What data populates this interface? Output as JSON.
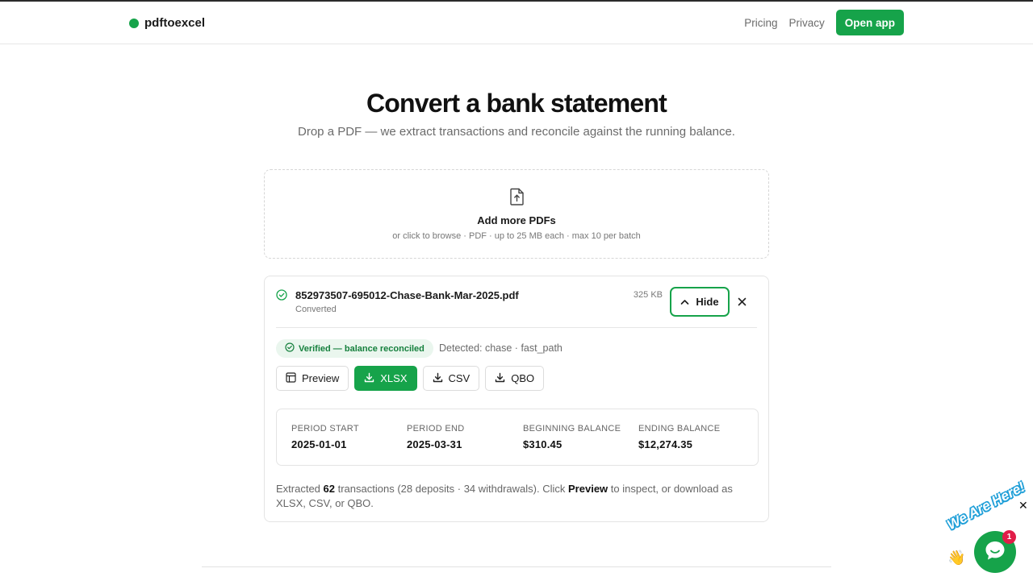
{
  "header": {
    "brand": "pdftoexcel",
    "nav": [
      {
        "label": "Pricing"
      },
      {
        "label": "Privacy"
      }
    ],
    "cta_label": "Open app"
  },
  "hero": {
    "title": "Convert a bank statement",
    "subtitle": "Drop a PDF — we extract transactions and reconcile against the running balance."
  },
  "dropzone": {
    "icon": "file-upload-icon",
    "title": "Add more PDFs",
    "hint": "or click to browse · PDF · up to 25 MB each · max 10 per batch"
  },
  "file": {
    "name": "852973507-695012-Chase-Bank-Mar-2025.pdf",
    "status": "Converted",
    "size": "325 KB",
    "hide_label": "Hide",
    "verified_label": "Verified — balance reconciled",
    "detected": "Detected: chase · fast_path",
    "actions": [
      {
        "label": "Preview",
        "icon": "table-icon"
      },
      {
        "label": "XLSX",
        "icon": "download-icon"
      },
      {
        "label": "CSV",
        "icon": "download-icon"
      },
      {
        "label": "QBO",
        "icon": "download-icon"
      }
    ],
    "summary": [
      {
        "label": "PERIOD START",
        "value": "2025-01-01"
      },
      {
        "label": "PERIOD END",
        "value": "2025-03-31"
      },
      {
        "label": "BEGINNING BALANCE",
        "value": "$310.45"
      },
      {
        "label": "ENDING BALANCE",
        "value": "$12,274.35"
      }
    ],
    "note": {
      "prefix": "Extracted ",
      "count": "62",
      "middle": " transactions (28 deposits · 34 withdrawals). Click ",
      "link": "Preview",
      "suffix": " to inspect, or download as XLSX, CSV, or QBO."
    }
  },
  "chat": {
    "tagline": "We Are Here!",
    "badge": "1",
    "close": "✕"
  },
  "colors": {
    "accent": "#16a34a",
    "verified_bg": "#eaf6ee",
    "badge": "#e11d48"
  }
}
